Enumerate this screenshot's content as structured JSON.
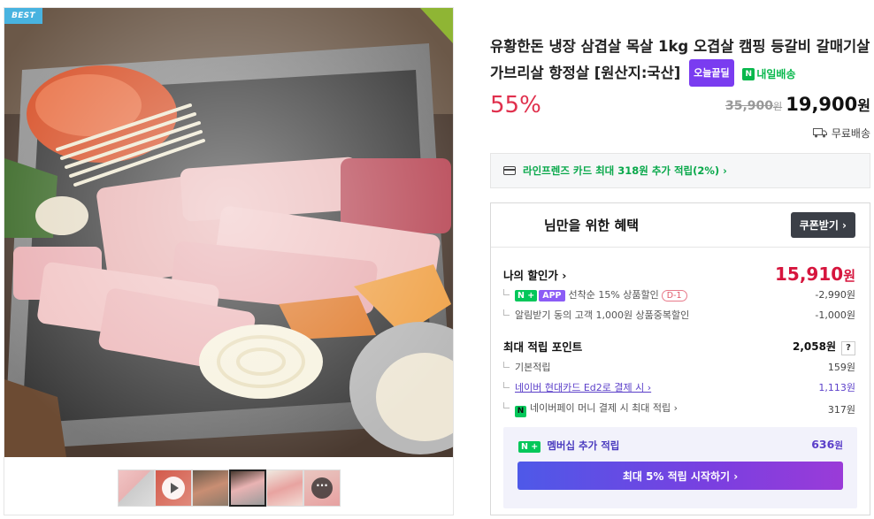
{
  "badge": {
    "best": "BEST"
  },
  "product": {
    "title": "유황한돈 냉장 삼겹살 목살 1kg 오겹살 캠핑 등갈비 갈매기살 가브리살 항정살 [원산지:국산]",
    "tag_today": "오늘끝딜",
    "tag_delivery": "내일배송",
    "tag_delivery_icon": "N",
    "discount_rate": "55%",
    "original_price": "35,900",
    "sale_price": "19,900",
    "currency": "원",
    "shipping": "무료배송"
  },
  "card_promo": {
    "text": "라인프렌즈 카드 최대 318원 추가 적립(2%) ›"
  },
  "benefit": {
    "title_suffix": "님만을 위한 혜택",
    "coupon_button": "쿠폰받기 ›",
    "my_discount_label": "나의 할인가 ›",
    "my_discount_price": "15,910",
    "items": [
      {
        "badge_n": "N +",
        "badge_app": "APP",
        "label": "선착순 15% 상품할인",
        "tag": "D-1",
        "value": "-2,990원"
      },
      {
        "label": "알림받기 동의 고객 1,000원 상품중복할인",
        "value": "-1,000원"
      }
    ],
    "points_label": "최대 적립 포인트",
    "points_value": "2,058원",
    "points_help": "?",
    "point_items": [
      {
        "label": "기본적립",
        "value": "159원"
      },
      {
        "label": "네이버 현대카드 Ed2로 결제 시 ›",
        "value": "1,113원"
      },
      {
        "icon": "N",
        "label": "네이버페이 머니 결제 시 최대 적립 ›",
        "value": "317원"
      }
    ],
    "membership": {
      "badge": "N +",
      "label": "멤버십 추가 적립",
      "value": "636",
      "currency": "원",
      "button": "최대 5% 적립 시작하기 ›"
    }
  },
  "colors": {
    "discount": "#e0304d",
    "my_price": "#d6153d",
    "naver_green": "#03c75a",
    "today_purple": "#7a3cf0",
    "member_purple": "#5b3fc9"
  }
}
